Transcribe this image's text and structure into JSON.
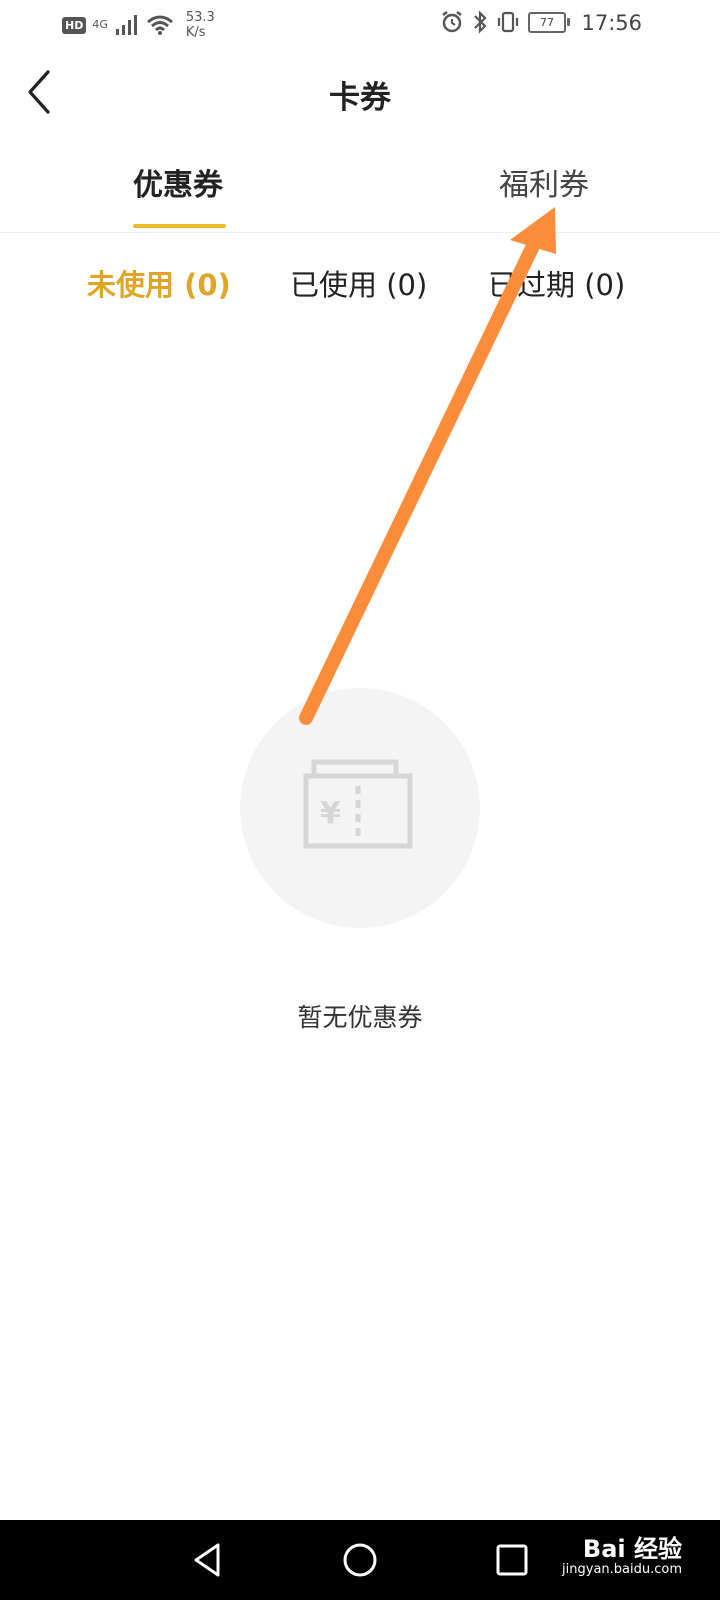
{
  "status_bar": {
    "hd_label": "HD",
    "network_type": "4G",
    "network_speed_value": "53.3",
    "network_speed_unit": "K/s",
    "battery_level": "77",
    "time": "17:56"
  },
  "header": {
    "title": "卡券",
    "back_icon": "chevron-left-icon"
  },
  "tabs": [
    {
      "label": "优惠券",
      "active": true
    },
    {
      "label": "福利券",
      "active": false
    }
  ],
  "subtabs": [
    {
      "label": "未使用 (0)",
      "active": true
    },
    {
      "label": "已使用 (0)",
      "active": false
    },
    {
      "label": "已过期 (0)",
      "active": false
    }
  ],
  "empty_state": {
    "icon": "coupon-icon",
    "message": "暂无优惠券"
  },
  "nav_bar": {
    "back": "triangle-back-icon",
    "home": "circle-home-icon",
    "recents": "square-recents-icon"
  },
  "watermark": {
    "brand": "Bai 经验",
    "url": "jingyan.baidu.com"
  },
  "colors": {
    "accent": "#f0b731",
    "active_subtab": "#e0a426",
    "annotation_arrow": "#fb8c3a"
  }
}
